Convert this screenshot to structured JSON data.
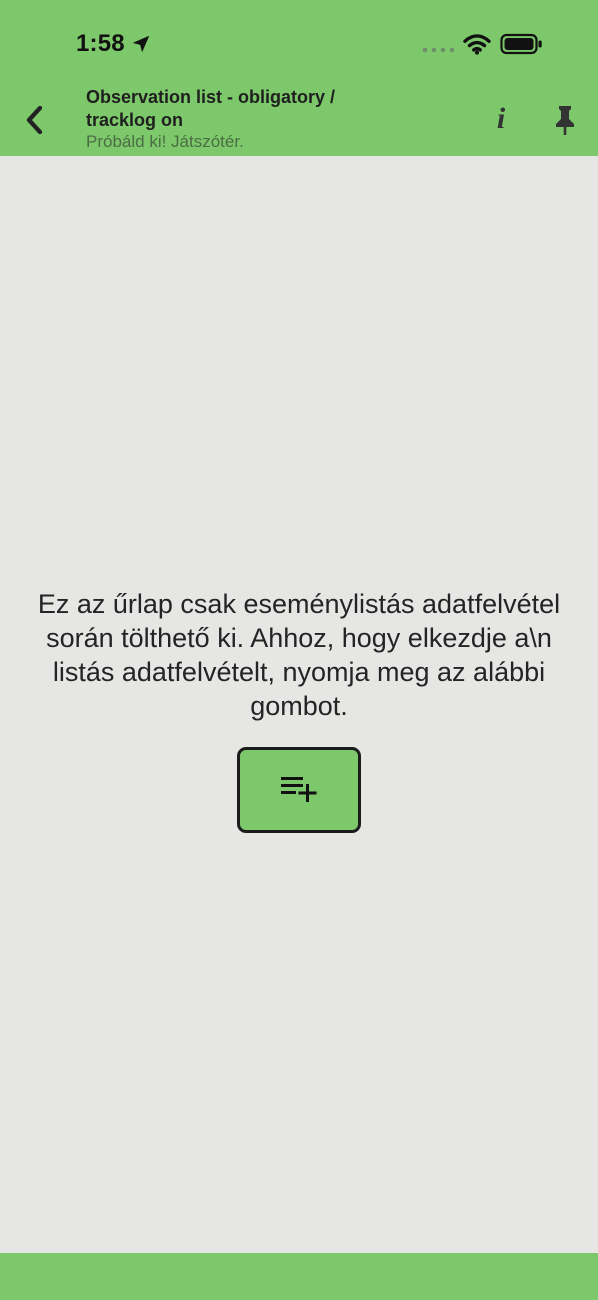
{
  "status_bar": {
    "time": "1:58",
    "location_icon": "location-arrow",
    "signal_icon": "cellular-signal-dots",
    "wifi_icon": "wifi",
    "battery_icon": "battery-full"
  },
  "header": {
    "title": "Observation list - obligatory / tracklog on",
    "subtitle": "Próbáld ki! Játszótér.",
    "back_icon": "chevron-left",
    "info_icon": "info",
    "pin_icon": "pin"
  },
  "main": {
    "message": "Ez az űrlap csak eseménylistás adatfelvétel során tölthető ki. Ahhoz, hogy elkezdje a\\n listás adatfelvételt, nyomja meg az alábbi gombot.",
    "start_list_icon": "playlist-add"
  },
  "colors": {
    "header_background": "#7dc86a",
    "body_background": "#e6e6e5",
    "button_background": "#7dc86a",
    "button_border": "#1b1b1b",
    "subtitle_text": "#4b6d45",
    "text": "#242424"
  }
}
